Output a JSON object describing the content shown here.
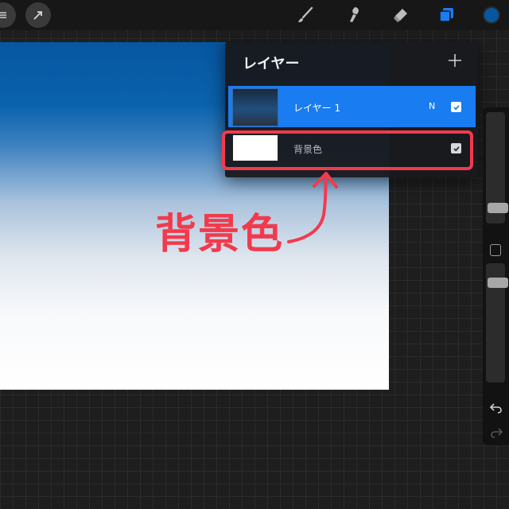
{
  "topbar": {
    "left_tools": [
      {
        "icon": "partial-menu-icon"
      },
      {
        "icon": "transform-arrow-icon"
      }
    ],
    "right_tools": [
      {
        "icon": "brush-icon"
      },
      {
        "icon": "smudge-icon"
      },
      {
        "icon": "eraser-icon"
      },
      {
        "icon": "layers-icon",
        "active": true
      },
      {
        "icon": "color-swatch-icon"
      }
    ],
    "colors": {
      "accent": "#1a7cf1",
      "current_color": "#0756a0"
    }
  },
  "layers_panel": {
    "title": "レイヤー",
    "add_icon": "plus-icon",
    "layers": [
      {
        "name": "レイヤー 1",
        "blend_mode": "N",
        "visible": true,
        "selected": true
      },
      {
        "name": "背景色",
        "visible": true,
        "selected": false
      }
    ]
  },
  "annotation": {
    "text": "背景色",
    "color": "#f23a4d"
  },
  "sidebar": {
    "icons": [
      "modify-square-icon",
      "undo-icon",
      "redo-icon"
    ]
  }
}
